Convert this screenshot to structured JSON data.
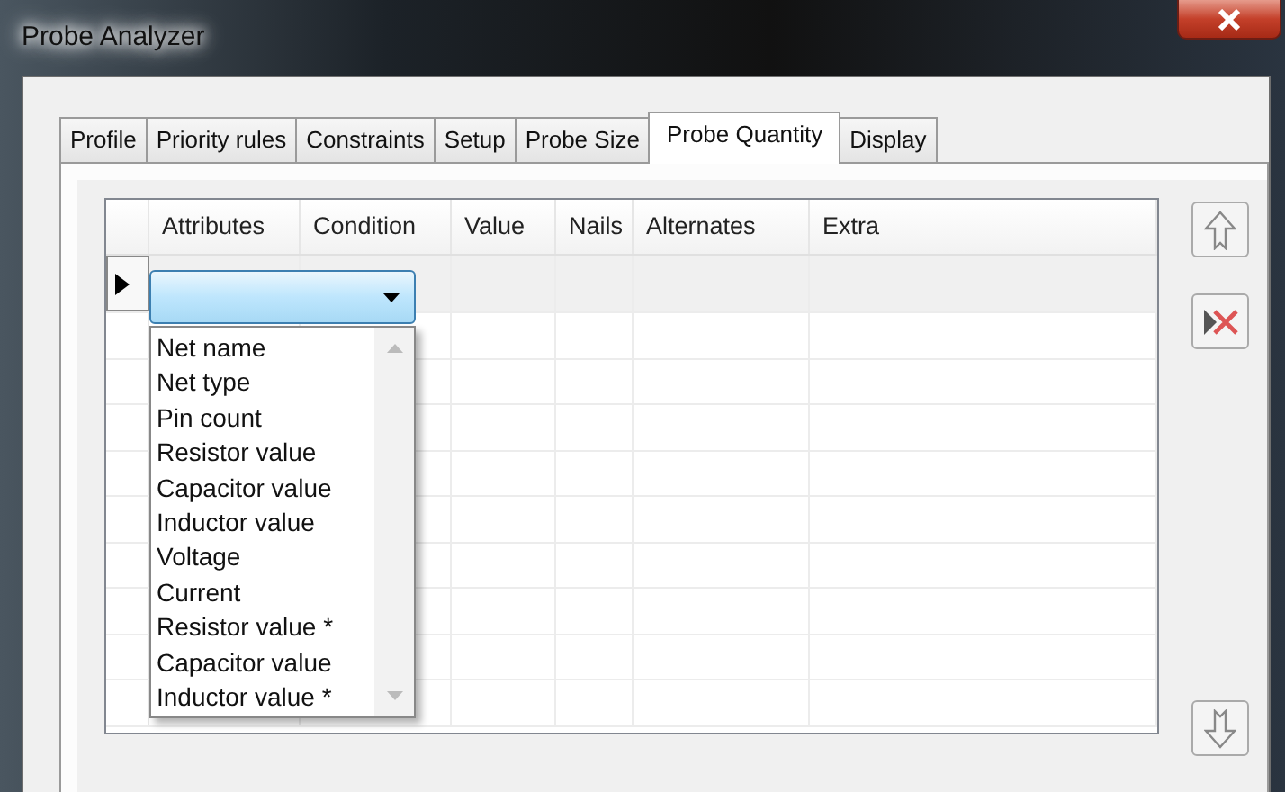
{
  "window": {
    "title": "Probe Analyzer"
  },
  "tabs": [
    {
      "label": "Profile",
      "selected": false
    },
    {
      "label": "Priority rules",
      "selected": false
    },
    {
      "label": "Constraints",
      "selected": false
    },
    {
      "label": "Setup",
      "selected": false
    },
    {
      "label": "Probe Size",
      "selected": false
    },
    {
      "label": "Probe Quantity",
      "selected": true
    },
    {
      "label": "Display",
      "selected": false
    }
  ],
  "grid": {
    "columns": [
      "Attributes",
      "Condition",
      "Value",
      "Nails",
      "Alternates",
      "Extra"
    ],
    "rows": [
      {
        "current": true
      },
      {
        "current": false
      },
      {
        "current": false
      },
      {
        "current": false
      },
      {
        "current": false
      },
      {
        "current": false
      },
      {
        "current": false
      },
      {
        "current": false
      },
      {
        "current": false
      },
      {
        "current": false
      }
    ]
  },
  "dropdown": {
    "open": true,
    "items": [
      "Net name",
      "Net type",
      "Pin count",
      "Resistor value",
      "Capacitor value",
      "Inductor value",
      "Voltage",
      "Current",
      "Resistor value *",
      "Capacitor value",
      "Inductor value *"
    ]
  },
  "side_buttons": [
    {
      "kind": "up"
    },
    {
      "kind": "delete"
    },
    {
      "kind": "down"
    }
  ]
}
